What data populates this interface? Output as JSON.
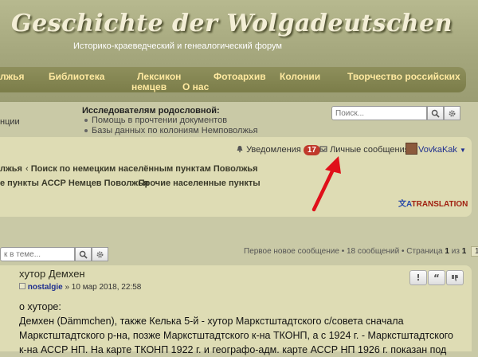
{
  "header": {
    "title": "Geschichte der Wolgadeutschen",
    "subtitle": "Историко-краеведческий и генеалогический форум"
  },
  "nav": {
    "items": [
      "лжья",
      "Библиотека",
      "Лексикон немцев",
      "Фотоархив",
      "Колонии",
      "Творчество российских",
      "О нас"
    ],
    "lexicon_line1": "Лексикон",
    "lexicon_line2": "немцев"
  },
  "research": {
    "title": "Исследователям родословной:",
    "links": [
      "Помощь в прочтении документов",
      "Базы данных по колониям Немповолжья"
    ],
    "left_cut": "нции"
  },
  "search": {
    "placeholder": "Поиск..."
  },
  "user_bar": {
    "notifications_label": "Уведомления",
    "notifications_count": "17",
    "messages_label": "Личные сообщения",
    "username": "VovkaKak"
  },
  "breadcrumbs": {
    "row1": [
      "лжья",
      "Поиск по немецким населённым пунктам Поволжья"
    ],
    "row2": [
      "е пункты АССР Немцев Поволжья",
      "Прочие населенные пункты"
    ]
  },
  "translation": "TRANSLATION",
  "topic_search": {
    "placeholder": "к в теме..."
  },
  "pagination": {
    "first_unread": "Первое новое сообщение",
    "messages": "18 сообщений",
    "page_label": "Страница",
    "current": "1",
    "of": "из",
    "total": "1"
  },
  "post": {
    "title": "хутор Демхен",
    "author": "nostalgie",
    "date": "» 10 мар 2018, 22:58",
    "lines": [
      "о хуторе:",
      "Демхен (Dämmchen), также Келька 5-й - хутор Маркстштадтского с/совета сначала",
      "Маркстштадтского р-на, позже Маркстштадтского к-на ТКОНП, а с 1924 г. - Маркстштадтского",
      "к-на АССР НП. На карте ТКОНП 1922 г. и географо-адм. карте АССР НП 1926 г. показан под"
    ]
  },
  "colors": {
    "accent": "#ffe9a0",
    "badge": "#c0392b",
    "link": "#1f2f8f",
    "arrow": "#e0101a"
  }
}
